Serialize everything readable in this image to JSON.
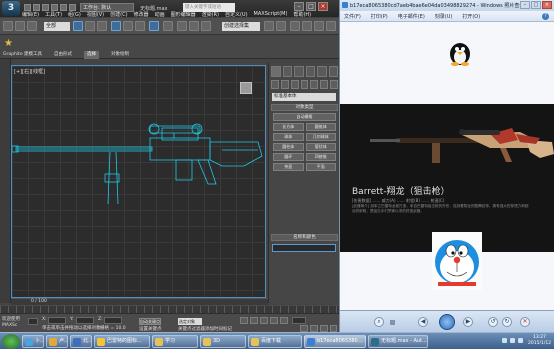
{
  "max": {
    "workspace": "工作台: 默认",
    "title": "无标题.max",
    "search_placeholder": "键入关键字或短语",
    "menu": [
      "编辑(E)",
      "工具(T)",
      "组(G)",
      "视图(V)",
      "创建(C)",
      "修改器",
      "动画",
      "图形编辑器",
      "渲染(R)",
      "自定义(U)",
      "MAXScript(M)",
      "帮助(H)"
    ],
    "selection_filter": "全部",
    "named_selection": "创建选择集",
    "ribbon_tabs": [
      "Graphite 建模工具",
      "自由形式",
      "选择",
      "对象绘制"
    ],
    "ribbon_active_tab": "选择",
    "viewport_label": "[+][右][线框]",
    "command_dropdown": "标准基本体",
    "rollout_object_type": "对象类型",
    "autogrid": "自动栅格",
    "primitive_buttons": [
      "长方体",
      "圆锥体",
      "球体",
      "几何球体",
      "圆柱体",
      "管状体",
      "圆环",
      "四棱锥",
      "茶壶",
      "平面"
    ],
    "rollout_name_color": "名称和颜色",
    "timeline_counter": "0 / 100",
    "status_left_top": "欢迎使用",
    "status_left_bottom": "MAXSc",
    "status_prompt": "单击或单击并拖动以选择对象",
    "status_field_x": "X:",
    "status_field_y": "Y:",
    "status_field_z": "Z:",
    "status_grid": "栅格 = 10.0",
    "status_add_time_tag": "添加时间标记",
    "auto_key": "自动关键点",
    "set_key": "设置关键点",
    "selected_object": "选定对象",
    "key_filters": "关键点过滤器"
  },
  "viewer": {
    "title": "b17eca8065380cd7aeb4bae6e04da03498829274 - Windows 照片查看器",
    "menu": [
      "文件(F)",
      "打印(P)",
      "电子邮件(E)",
      "刻录(U)",
      "打开(O)"
    ],
    "help_icon": "help-icon",
    "gun_title": "Barrett-翔龙（狙击枪）",
    "gun_sub": "[伤害数据]  ……  威力(A)  ……  射程(B)  ……  射速(C)",
    "gun_desc": "[武器简介] 冠军之巴雷特龙卷打造，来自巴雷特狙击枪的外形，铭刻着翔龙的图腾纹饰，拥有强大的穿透力和超远的射程，是狙击手们梦寐以求的终极武器。"
  },
  "taskbar": {
    "items": [
      "卜..",
      "卢..",
      "北..",
      "巴雷特的图标...",
      "学习",
      "3D",
      "百度下载",
      "b17eca8065380...",
      "无标题.max - Aut..."
    ],
    "clock_time": "13:27",
    "clock_date": "2015/1/12"
  }
}
